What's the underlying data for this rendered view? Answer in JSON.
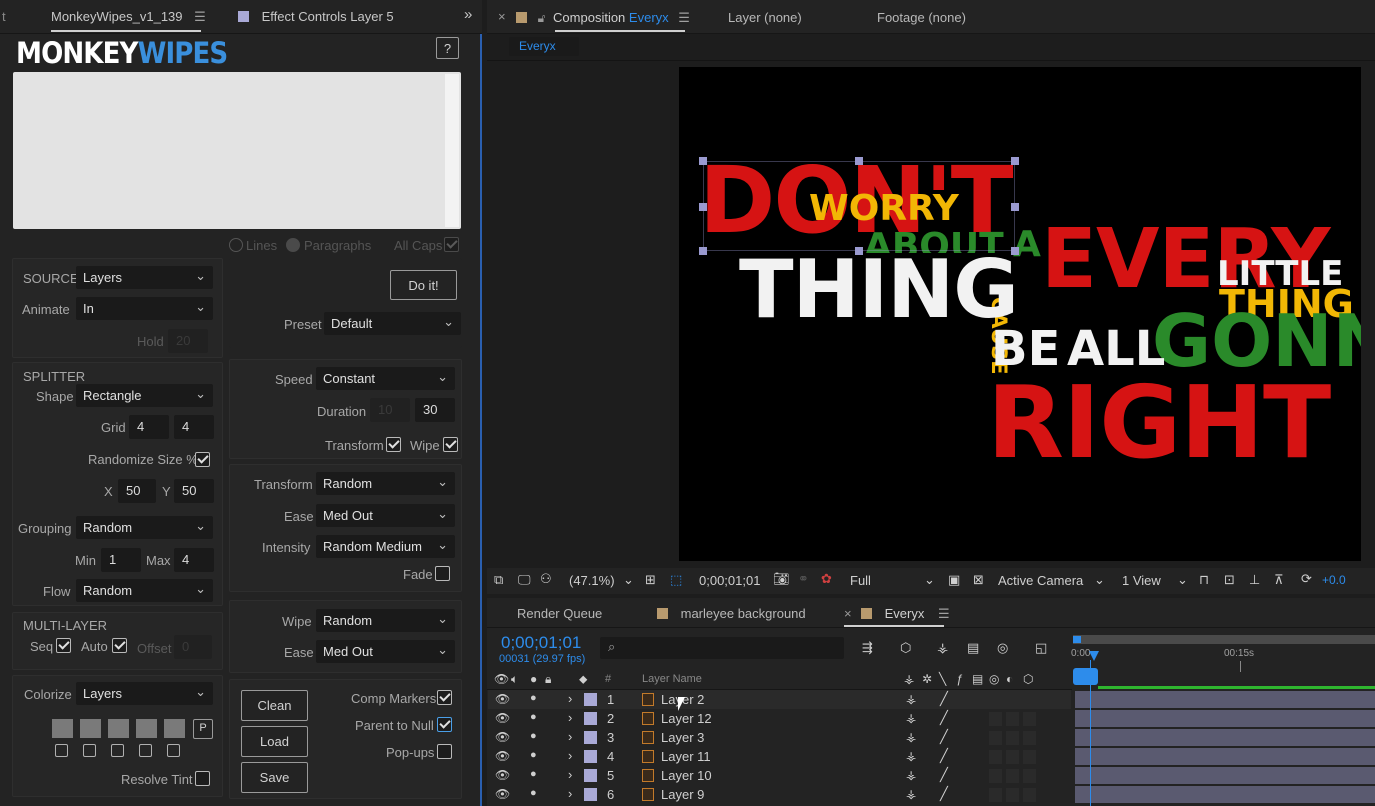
{
  "left_tabs": {
    "active": "MonkeyWipes_v1_139",
    "other": "Effect Controls Layer 5",
    "edge": "t",
    "more": "»"
  },
  "plugin": {
    "logo_a": "MONKEY",
    "logo_b": "WIPES",
    "help": "?",
    "options": {
      "lines": "Lines",
      "paragraphs": "Paragraphs",
      "all_caps": "All Caps"
    },
    "source": {
      "label": "SOURCE",
      "value": "Layers"
    },
    "animate": {
      "label": "Animate",
      "value": "In"
    },
    "hold": {
      "label": "Hold",
      "value": "20"
    },
    "do_it": "Do it!",
    "preset": {
      "label": "Preset",
      "value": "Default"
    },
    "splitter": {
      "title": "SPLITTER",
      "shape_label": "Shape",
      "shape": "Rectangle",
      "grid_label": "Grid",
      "grid_x": "4",
      "grid_y": "4",
      "randomize_label": "Randomize Size %",
      "x_label": "X",
      "x": "50",
      "y_label": "Y",
      "y": "50",
      "grouping_label": "Grouping",
      "grouping": "Random",
      "min_label": "Min",
      "min": "1",
      "max_label": "Max",
      "max": "4",
      "flow_label": "Flow",
      "flow": "Random"
    },
    "speed": {
      "label": "Speed",
      "value": "Constant",
      "duration_label": "Duration",
      "duration_a": "10",
      "duration_b": "30",
      "transform_label": "Transform",
      "wipe_label": "Wipe"
    },
    "transform": {
      "label": "Transform",
      "value": "Random",
      "ease_label": "Ease",
      "ease": "Med Out",
      "intensity_label": "Intensity",
      "intensity": "Random Medium",
      "fade_label": "Fade"
    },
    "wipe": {
      "label": "Wipe",
      "value": "Random",
      "ease_label": "Ease",
      "ease": "Med Out"
    },
    "multilayer": {
      "title": "MULTI-LAYER",
      "seq": "Seq",
      "auto": "Auto",
      "offset": "Offset",
      "offset_value": "0"
    },
    "colorize": {
      "label": "Colorize",
      "value": "Layers",
      "p": "P",
      "resolve": "Resolve Tint"
    },
    "buttons": {
      "clean": "Clean",
      "load": "Load",
      "save": "Save"
    },
    "flags": {
      "comp_markers": "Comp Markers",
      "parent_null": "Parent to Null",
      "popups": "Pop-ups"
    }
  },
  "comp_tabs": {
    "close": "×",
    "comp_prefix": "Composition",
    "comp_name": "Everyx",
    "layer": "Layer (none)",
    "footage": "Footage (none)",
    "sub_tab": "Everyx"
  },
  "artwork": {
    "dont": "DON'T",
    "worry": "WORRY",
    "about": "ABOUT",
    "a": "A",
    "cause": "CAUSE",
    "every": "EVERY",
    "thing": "THING",
    "little": "LITTLE",
    "thing2": "THING",
    "be": "BE",
    "all": "ALL",
    "gonna": "GONNA",
    "right": "RIGHT"
  },
  "viewer_bar": {
    "zoom": "(47.1%)",
    "timecode": "0;00;01;01",
    "resolution": "Full",
    "camera": "Active Camera",
    "views": "1 View",
    "exposure": "+0.0"
  },
  "timeline_tabs": {
    "render_queue": "Render Queue",
    "bg": "marleyee background",
    "everyx": "Everyx",
    "close": "×"
  },
  "timeline": {
    "timecode": "0;00;01;01",
    "frames": "00031 (29.97 fps)",
    "search_placeholder": "",
    "col_num": "#",
    "col_name": "Layer Name",
    "ruler_start": "0:00",
    "ruler_mark": "00:15s",
    "layers": [
      {
        "num": "1",
        "name": "Layer 2"
      },
      {
        "num": "2",
        "name": "Layer 12"
      },
      {
        "num": "3",
        "name": "Layer 3"
      },
      {
        "num": "4",
        "name": "Layer 11"
      },
      {
        "num": "5",
        "name": "Layer 10"
      },
      {
        "num": "6",
        "name": "Layer 9"
      }
    ]
  },
  "colors": {
    "accent_blue": "#2d8ceb",
    "red": "#d61313",
    "yellow": "#f2b705",
    "green": "#2a8a2a",
    "label_purple": "#a9a9d6",
    "label_tan": "#b89a6e"
  }
}
